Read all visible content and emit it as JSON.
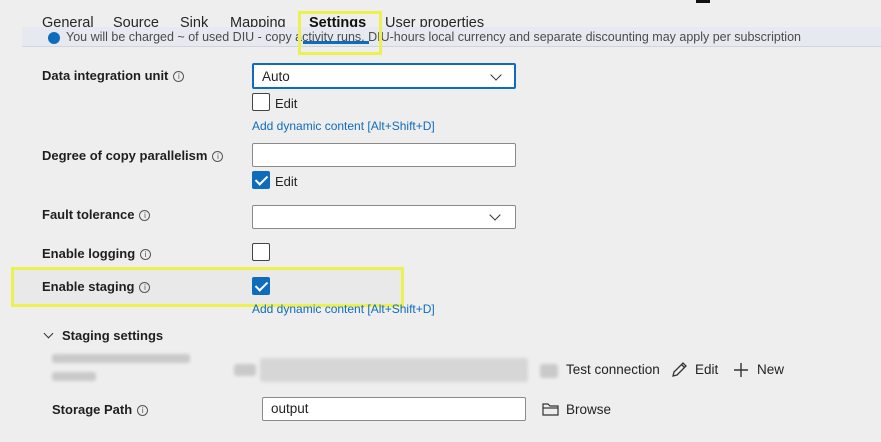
{
  "tabs": [
    {
      "label": "General"
    },
    {
      "label": "Source"
    },
    {
      "label": "Sink"
    },
    {
      "label": "Mapping"
    },
    {
      "label": "Settings"
    },
    {
      "label": "User properties"
    }
  ],
  "active_tab": "Settings",
  "banner": {
    "text": "You will be charged ~ of used DIU - copy activity runs. DIU-hours local currency and separate discounting may apply per subscription"
  },
  "settings": {
    "diu": {
      "label": "Data integration unit",
      "value": "Auto",
      "edit_label": "Edit",
      "edit_checked": false,
      "dynamic_link": "Add dynamic content [Alt+Shift+D]"
    },
    "parallelism": {
      "label": "Degree of copy parallelism",
      "value": "",
      "edit_label": "Edit",
      "edit_checked": true
    },
    "fault_tolerance": {
      "label": "Fault tolerance",
      "value": ""
    },
    "logging": {
      "label": "Enable logging",
      "checked": false
    },
    "staging": {
      "label": "Enable staging",
      "checked": true,
      "dynamic_link": "Add dynamic content [Alt+Shift+D]"
    }
  },
  "staging_settings": {
    "title": "Staging settings",
    "test_connection_label": "Test connection",
    "edit_label": "Edit",
    "new_label": "New",
    "storage_path_label": "Storage Path",
    "storage_path_value": "output",
    "browse_label": "Browse"
  },
  "colors": {
    "accent": "#0f6cbd",
    "highlight": "#ecf050",
    "background": "#eeeeee"
  },
  "icons": {
    "info": "circle-i",
    "chevron": "chevron-down",
    "test_connection": "plug-icon",
    "edit": "pencil-icon",
    "new": "plus-icon",
    "browse": "folder-icon"
  }
}
